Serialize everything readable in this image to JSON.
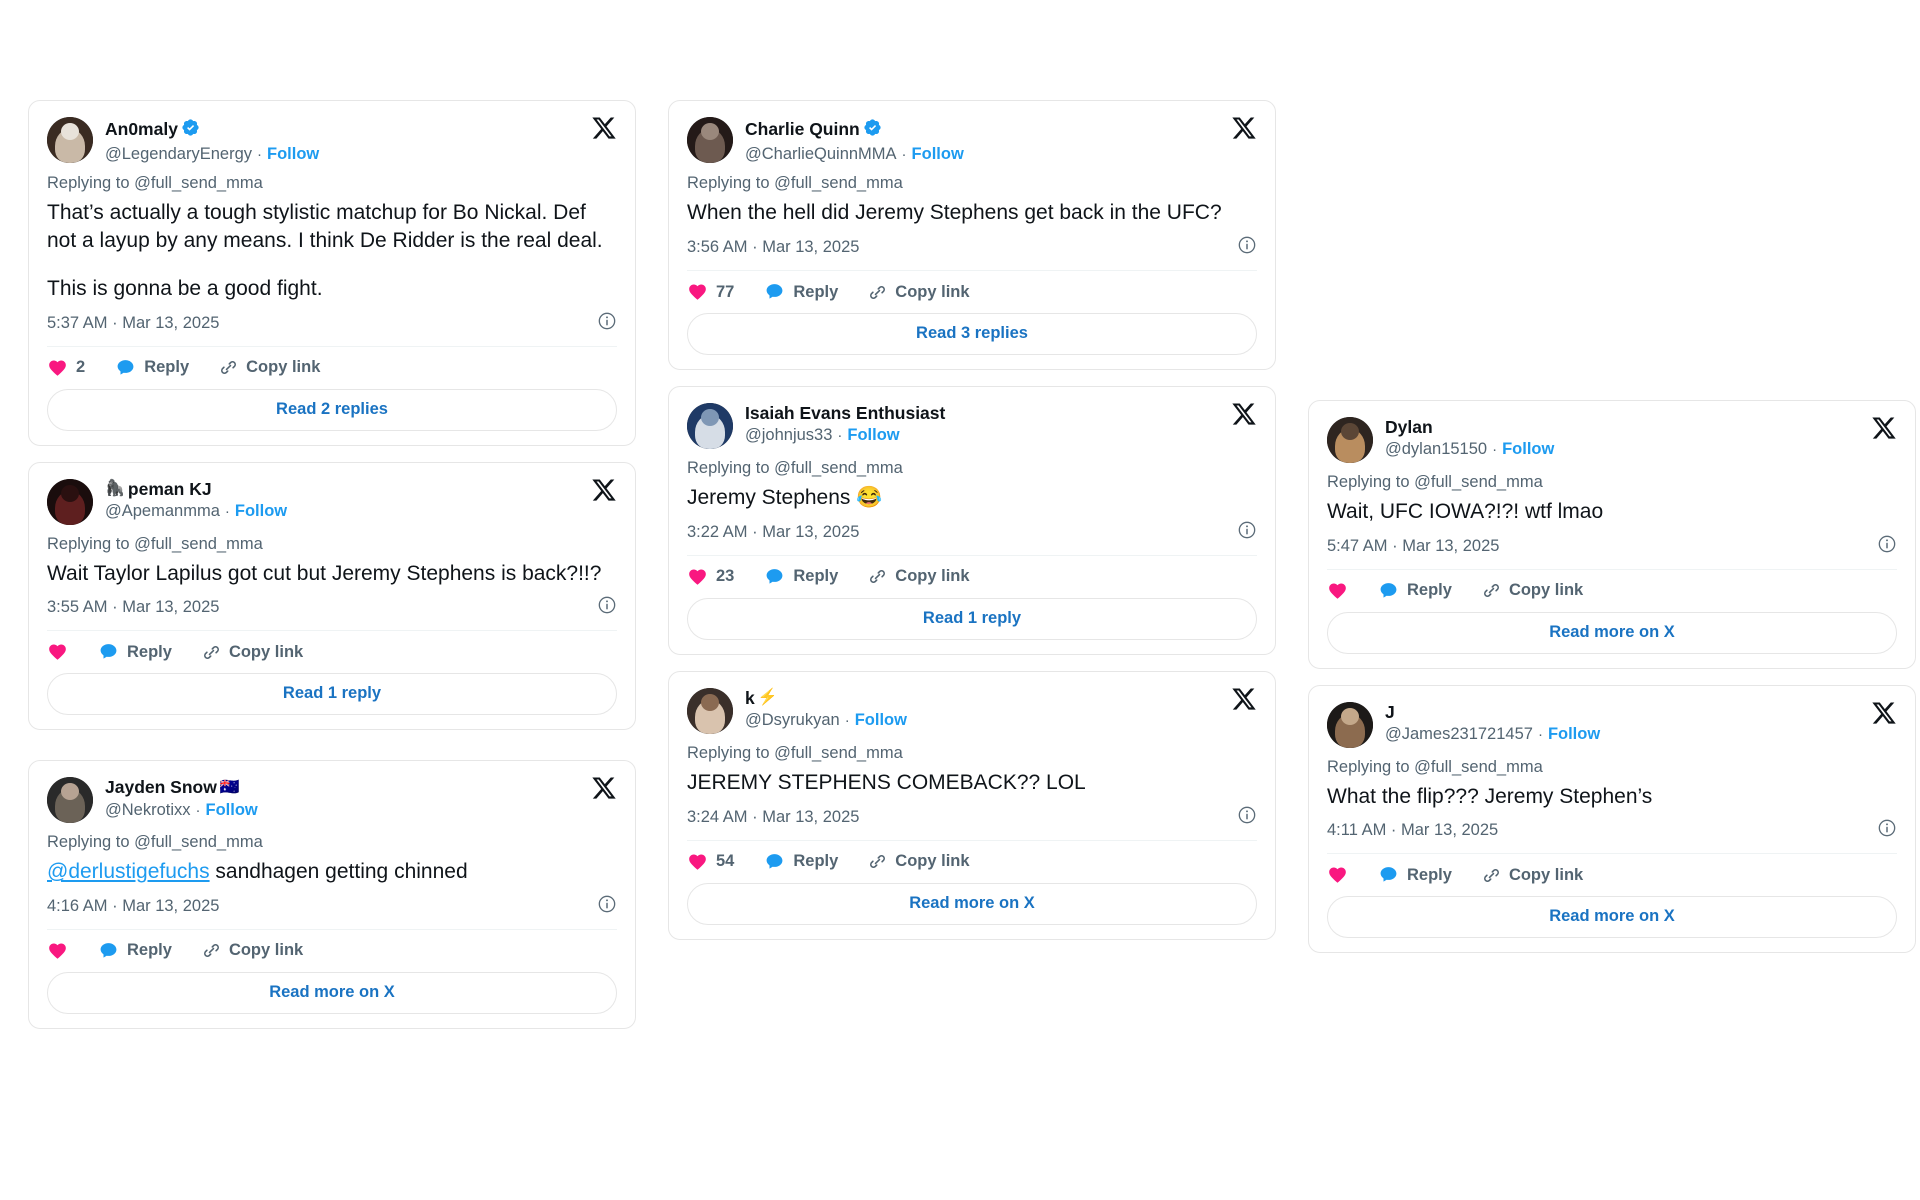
{
  "common": {
    "replying_to": "Replying to @full_send_mma",
    "follow_label": "Follow",
    "reply_label": "Reply",
    "copy_link_label": "Copy link",
    "separator": "·",
    "x_logo_icon": "x-logo-icon",
    "heart_icon": "heart-icon",
    "reply_icon": "reply-bubble-icon",
    "copy_icon": "link-chain-icon",
    "info_icon": "info-circle-icon",
    "verified_icon": "verified-badge-icon",
    "accent_blue": "#1d9bf0",
    "link_blue": "#1a73c2",
    "heart_pink": "#f91880",
    "muted_gray": "#536471",
    "text_black": "#0f1419",
    "border_gray": "#e6e6e6"
  },
  "columns": [
    {
      "id": "column-1",
      "cards": [
        {
          "name": "An0maly",
          "verified": true,
          "emoji": "",
          "handle": "@LegendaryEnergy",
          "body_lines": [
            "That’s actually a tough stylistic matchup for Bo Nickal. Def not a layup by any means. I think De Ridder is the real deal.",
            "",
            "This is gonna be a good fight."
          ],
          "mention": "",
          "timestamp": "5:37 AM · Mar 13, 2025",
          "likes": "2",
          "read_more": "Read 2 replies"
        },
        {
          "name": "peman KJ",
          "verified": false,
          "emoji": "🦍",
          "handle": "@Apemanmma",
          "body_lines": [
            "Wait Taylor Lapilus got cut but Jeremy Stephens is back?!!?"
          ],
          "mention": "",
          "timestamp": "3:55 AM · Mar 13, 2025",
          "likes": "",
          "read_more": "Read 1 reply"
        },
        {
          "name": "Jayden Snow",
          "verified": false,
          "emoji": "🇦🇺",
          "handle": "@Nekrotixx",
          "body_lines": [
            " sandhagen getting chinned"
          ],
          "mention": "@derlustigefuchs",
          "timestamp": "4:16 AM · Mar 13, 2025",
          "likes": "",
          "read_more": "Read more on X"
        }
      ]
    },
    {
      "id": "column-2",
      "cards": [
        {
          "name": "Charlie Quinn",
          "verified": true,
          "emoji": "",
          "handle": "@CharlieQuinnMMA",
          "body_lines": [
            "When the hell did Jeremy Stephens get back in the UFC?"
          ],
          "mention": "",
          "timestamp": "3:56 AM · Mar 13, 2025",
          "likes": "77",
          "read_more": "Read 3 replies"
        },
        {
          "name": "Isaiah Evans Enthusiast",
          "verified": false,
          "emoji": "",
          "handle": "@johnjus33",
          "body_lines": [
            "Jeremy Stephens 😂"
          ],
          "mention": "",
          "timestamp": "3:22 AM · Mar 13, 2025",
          "likes": "23",
          "read_more": "Read 1 reply"
        },
        {
          "name": "k",
          "verified": false,
          "emoji": "⚡",
          "handle": "@Dsyrukyan",
          "body_lines": [
            "JEREMY STEPHENS COMEBACK?? LOL"
          ],
          "mention": "",
          "timestamp": "3:24 AM · Mar 13, 2025",
          "likes": "54",
          "read_more": "Read more on X"
        }
      ]
    },
    {
      "id": "column-3",
      "cards": [
        {
          "name": "Dylan",
          "verified": false,
          "emoji": "",
          "handle": "@dylan15150",
          "body_lines": [
            "Wait, UFC IOWA?!?! wtf lmao"
          ],
          "mention": "",
          "timestamp": "5:47 AM · Mar 13, 2025",
          "likes": "",
          "read_more": "Read more on X"
        },
        {
          "name": "J",
          "verified": false,
          "emoji": "",
          "handle": "@James231721457",
          "body_lines": [
            "What the flip??? Jeremy Stephen’s"
          ],
          "mention": "",
          "timestamp": "4:11 AM · Mar 13, 2025",
          "likes": "",
          "read_more": "Read more on X"
        }
      ]
    }
  ]
}
